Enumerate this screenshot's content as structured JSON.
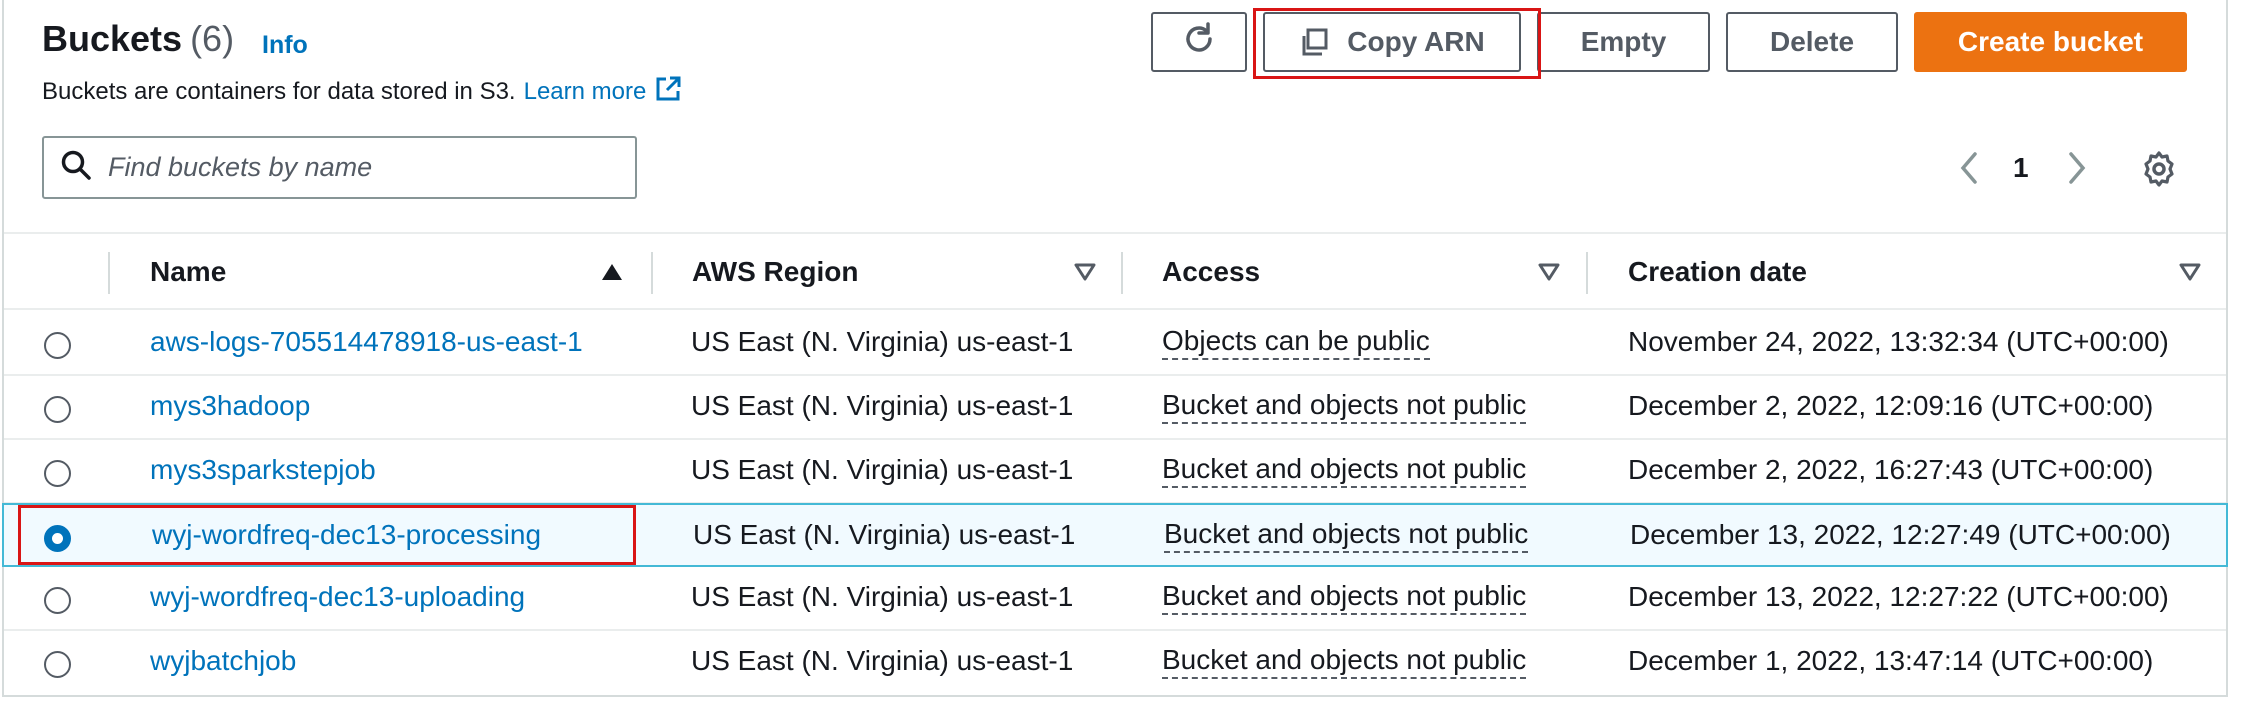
{
  "header": {
    "title": "Buckets",
    "count": "(6)",
    "info_label": "Info",
    "description": "Buckets are containers for data stored in S3.",
    "learn_more": "Learn more"
  },
  "toolbar": {
    "refresh_icon": "refresh-icon",
    "copy_arn_label": "Copy ARN",
    "empty_label": "Empty",
    "delete_label": "Delete",
    "create_label": "Create bucket"
  },
  "search": {
    "placeholder": "Find buckets by name",
    "value": ""
  },
  "pagination": {
    "current_page": "1"
  },
  "columns": {
    "name": "Name",
    "region": "AWS Region",
    "access": "Access",
    "creation_date": "Creation date"
  },
  "rows": [
    {
      "name": "aws-logs-705514478918-us-east-1",
      "region": "US East (N. Virginia) us-east-1",
      "access": "Objects can be public",
      "created": "November 24, 2022, 13:32:34 (UTC+00:00)",
      "selected": false
    },
    {
      "name": "mys3hadoop",
      "region": "US East (N. Virginia) us-east-1",
      "access": "Bucket and objects not public",
      "created": "December 2, 2022, 12:09:16 (UTC+00:00)",
      "selected": false
    },
    {
      "name": "mys3sparkstepjob",
      "region": "US East (N. Virginia) us-east-1",
      "access": "Bucket and objects not public",
      "created": "December 2, 2022, 16:27:43 (UTC+00:00)",
      "selected": false
    },
    {
      "name": "wyj-wordfreq-dec13-processing",
      "region": "US East (N. Virginia) us-east-1",
      "access": "Bucket and objects not public",
      "created": "December 13, 2022, 12:27:49 (UTC+00:00)",
      "selected": true
    },
    {
      "name": "wyj-wordfreq-dec13-uploading",
      "region": "US East (N. Virginia) us-east-1",
      "access": "Bucket and objects not public",
      "created": "December 13, 2022, 12:27:22 (UTC+00:00)",
      "selected": false
    },
    {
      "name": "wyjbatchjob",
      "region": "US East (N. Virginia) us-east-1",
      "access": "Bucket and objects not public",
      "created": "December 1, 2022, 13:47:14 (UTC+00:00)",
      "selected": false
    }
  ],
  "colors": {
    "link": "#0073bb",
    "primary": "#ec7211",
    "highlight": "#d91515",
    "selected_bg": "#f1faff"
  }
}
